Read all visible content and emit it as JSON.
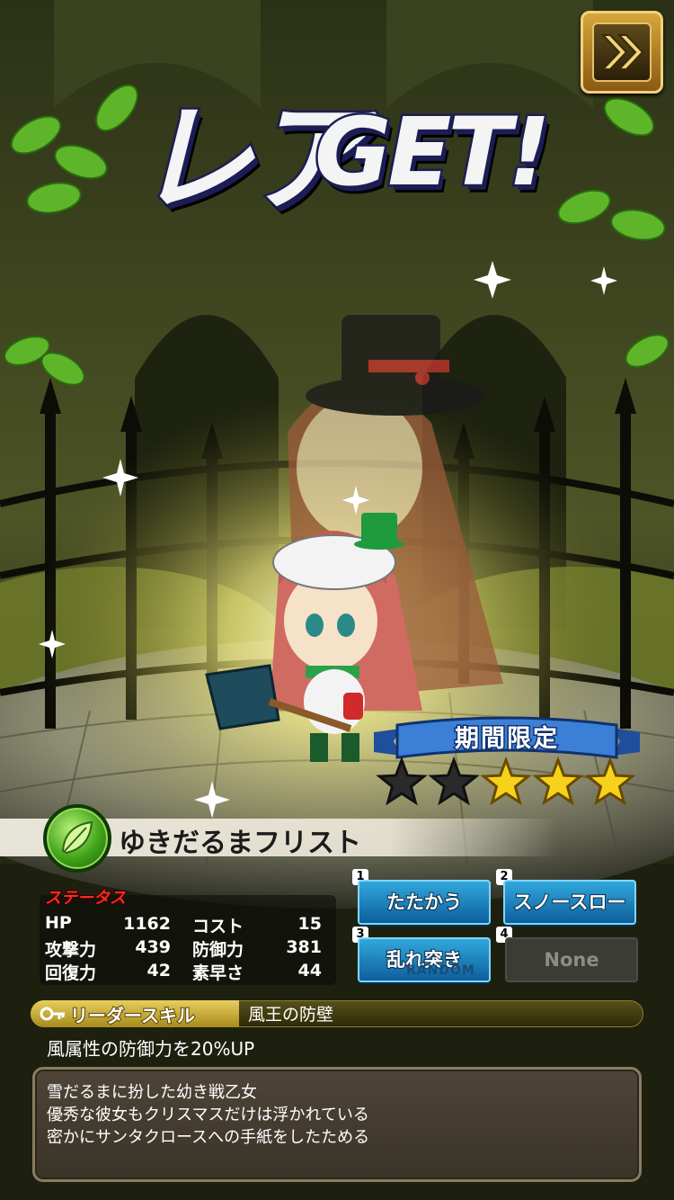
{
  "title": {
    "kana": "レア",
    "latin": "GET!"
  },
  "skip_button": {
    "icon": "fast-forward-icon"
  },
  "badge": {
    "label": "期間限定"
  },
  "rarity": {
    "filled": 3,
    "total": 5,
    "filled_color": "#f7d21c",
    "empty_color": "#2a2a2a"
  },
  "character": {
    "name": "ゆきだるまフリスト",
    "element_icon": "leaf-element-icon",
    "element_color": "#3fa218"
  },
  "status": {
    "title": "ステータス",
    "left": [
      {
        "label": "HP",
        "value": "1162"
      },
      {
        "label": "攻撃力",
        "value": "439"
      },
      {
        "label": "回復力",
        "value": "42"
      }
    ],
    "right": [
      {
        "label": "コスト",
        "value": "15"
      },
      {
        "label": "防御力",
        "value": "381"
      },
      {
        "label": "素早さ",
        "value": "44"
      }
    ]
  },
  "skills": [
    {
      "slot": "1",
      "label": "たたかう"
    },
    {
      "slot": "2",
      "label": "スノースロー"
    },
    {
      "slot": "3",
      "label": "乱れ突き",
      "tag": "RANDOM"
    },
    {
      "slot": "4",
      "label": "None"
    }
  ],
  "leader_skill": {
    "label": "リーダースキル",
    "name": "風王の防壁",
    "description": "風属性の防御力を20%UP"
  },
  "flavor": [
    "雪だるまに扮した幼き戦乙女",
    "優秀な彼女もクリスマスだけは浮かれている",
    "密かにサンタクロースへの手紙をしたためる"
  ]
}
